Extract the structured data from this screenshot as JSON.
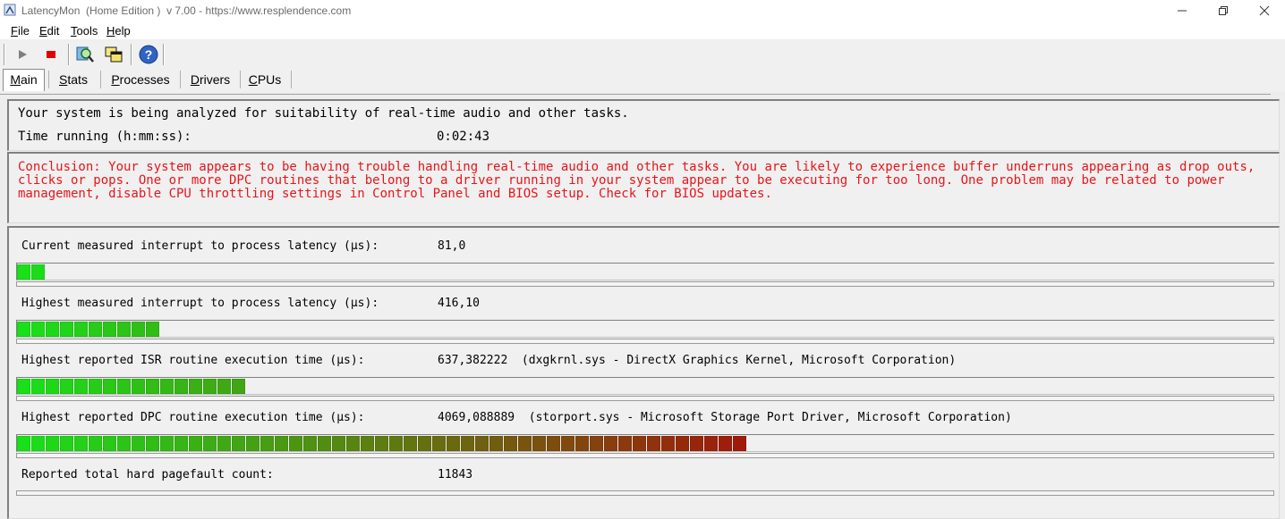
{
  "window": {
    "title_app": "LatencyMon",
    "title_edition": "(Home Edition )",
    "title_version": "v 7.00",
    "title_url": "https://www.resplendence.com"
  },
  "menu": [
    {
      "label": "File",
      "mnemonic": "F",
      "rest": "ile"
    },
    {
      "label": "Edit",
      "mnemonic": "E",
      "rest": "dit"
    },
    {
      "label": "Tools",
      "mnemonic": "T",
      "rest": "ools"
    },
    {
      "label": "Help",
      "mnemonic": "H",
      "rest": "elp"
    }
  ],
  "toolbar": {
    "icons": [
      "play-icon",
      "stop-icon",
      "search-icon",
      "windows-icon",
      "help-icon"
    ]
  },
  "tabs": [
    {
      "label": "Main",
      "mnemonic": "M",
      "rest": "ain",
      "active": true
    },
    {
      "label": "Stats",
      "mnemonic": "S",
      "rest": "tats",
      "active": false
    },
    {
      "label": "Processes",
      "mnemonic": "P",
      "rest": "rocesses",
      "active": false
    },
    {
      "label": "Drivers",
      "mnemonic": "D",
      "rest": "rivers",
      "active": false
    },
    {
      "label": "CPUs",
      "mnemonic": "C",
      "rest": "PUs",
      "active": false
    }
  ],
  "status": {
    "analyzing_text": "Your system is being analyzed for suitability of real-time audio and other tasks.",
    "time_label": "Time running (h:mm:ss):",
    "time_value": "0:02:43"
  },
  "conclusion": {
    "text": "Conclusion: Your system appears to be having trouble handling real-time audio and other tasks. You are likely to experience buffer underruns appearing as drop outs, clicks or pops. One or more DPC routines that belong to a driver running in your system appear to be executing for too long. One problem may be related to power management, disable CPU throttling settings in Control Panel and BIOS setup. Check for BIOS updates.",
    "color": "#e8141a"
  },
  "metrics": [
    {
      "label": "Current measured interrupt to process latency (µs):",
      "value": "81,0",
      "segments": 2
    },
    {
      "label": "Highest measured interrupt to process latency (µs):",
      "value": "416,10",
      "segments": 10
    },
    {
      "label": "Highest reported ISR routine execution time (µs):",
      "value": "637,382222  (dxgkrnl.sys - DirectX Graphics Kernel, Microsoft Corporation)",
      "segments": 16
    },
    {
      "label": "Highest reported DPC routine execution time (µs):",
      "value": "4069,088889  (storport.sys - Microsoft Storage Port Driver, Microsoft Corporation)",
      "segments": 51
    },
    {
      "label": "Reported total hard pagefault count:",
      "value": "11843",
      "segments": 0
    }
  ],
  "colors": {
    "meter_green": "#19e019",
    "meter_red": "#a01a0a"
  }
}
